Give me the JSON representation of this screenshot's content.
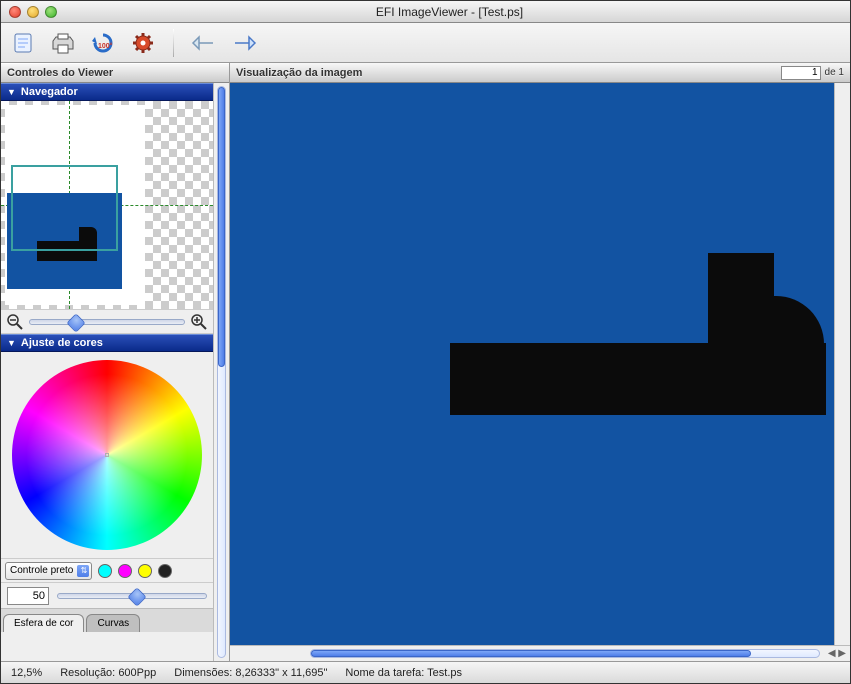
{
  "window": {
    "title": "EFI ImageViewer - [Test.ps]"
  },
  "sidebar": {
    "title": "Controles do Viewer",
    "navigator": {
      "title": "Navegador"
    },
    "color": {
      "title": "Ajuste de cores",
      "dropdown": "Controle preto",
      "value": "50",
      "tabs": {
        "sphere": "Esfera de cor",
        "curves": "Curvas"
      }
    }
  },
  "preview": {
    "title": "Visualização da imagem",
    "page_input": "1",
    "page_of": "de 1"
  },
  "status": {
    "zoom": "12,5%",
    "resolution_label": "Resolução:",
    "resolution_value": "600Ppp",
    "dimensions_label": "Dimensões:",
    "dimensions_value": "8,26333\" x 11,695\"",
    "taskname_label": "Nome da tarefa:",
    "taskname_value": "Test.ps"
  }
}
